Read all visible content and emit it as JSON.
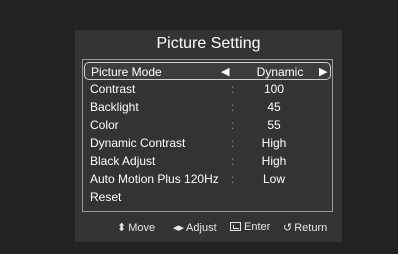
{
  "title": "Picture Setting",
  "selected_row": {
    "label": "Picture Mode",
    "left_arrow": "◀",
    "value": "Dynamic",
    "right_arrow": "▶"
  },
  "rows": [
    {
      "label": "Contrast",
      "sep": ":",
      "value": "100"
    },
    {
      "label": "Backlight",
      "sep": ":",
      "value": "45"
    },
    {
      "label": "Color",
      "sep": ":",
      "value": "55"
    },
    {
      "label": "Dynamic Contrast",
      "sep": ":",
      "value": "High"
    },
    {
      "label": "Black Adjust",
      "sep": ":",
      "value": "High"
    },
    {
      "label": "Auto Motion Plus 120Hz",
      "sep": ":",
      "value": "Low"
    },
    {
      "label": "Reset",
      "sep": "",
      "value": ""
    }
  ],
  "footer": {
    "move_icon": "⬍",
    "move_label": "Move",
    "adjust_icon": "◂▸",
    "adjust_label": "Adjust",
    "enter_label": "Enter",
    "return_icon": "↺",
    "return_label": "Return"
  }
}
